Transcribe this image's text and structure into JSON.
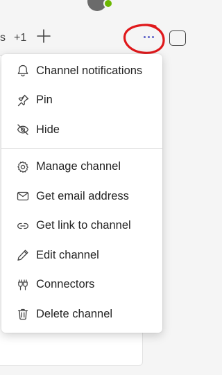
{
  "tabbar": {
    "cut_tab_label": "s",
    "more_tabs_label": "+1"
  },
  "menu": {
    "items": [
      {
        "label": "Channel notifications",
        "icon": "bell-icon"
      },
      {
        "label": "Pin",
        "icon": "pin-icon"
      },
      {
        "label": "Hide",
        "icon": "eye-off-icon"
      },
      {
        "label": "Manage channel",
        "icon": "gear-icon"
      },
      {
        "label": "Get email address",
        "icon": "mail-icon"
      },
      {
        "label": "Get link to channel",
        "icon": "link-icon"
      },
      {
        "label": "Edit channel",
        "icon": "pencil-icon"
      },
      {
        "label": "Connectors",
        "icon": "plug-icon"
      },
      {
        "label": "Delete channel",
        "icon": "trash-icon"
      }
    ]
  },
  "colors": {
    "accent": "#5b5fc7",
    "annotation": "#e0181b",
    "presence": "#6bb700"
  }
}
